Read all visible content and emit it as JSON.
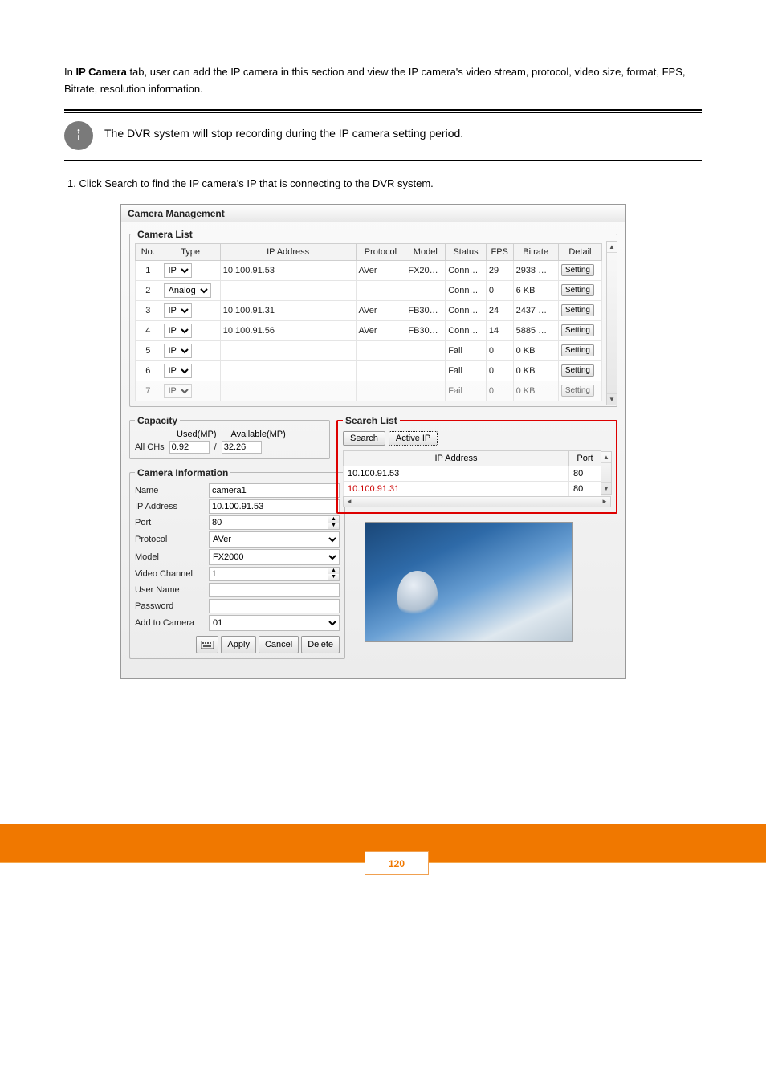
{
  "intro": {
    "part1_prefix": "In ",
    "part1_bold": "IP Camera",
    "part1_suffix": " tab, user can add the IP camera in this section and view the IP camera's video stream, protocol, video size, format, FPS, Bitrate, resolution information."
  },
  "info_note": "The DVR system will stop recording during the IP camera setting period.",
  "step_text": "1. Click Search to find the IP camera's IP that is connecting to the DVR system.",
  "window": {
    "title": "Camera Management",
    "camera_list": {
      "legend": "Camera List",
      "cols": {
        "no": "No.",
        "type": "Type",
        "ip": "IP Address",
        "protocol": "Protocol",
        "model": "Model",
        "status": "Status",
        "fps": "FPS",
        "bitrate": "Bitrate",
        "detail": "Detail"
      },
      "rows": [
        {
          "no": "1",
          "type": "IP",
          "ip": "10.100.91.53",
          "protocol": "AVer",
          "model": "FX20…",
          "status": "Conn…",
          "fps": "29",
          "bitrate": "2938 …",
          "detail": "Setting"
        },
        {
          "no": "2",
          "type": "Analog",
          "ip": "",
          "protocol": "",
          "model": "",
          "status": "Conn…",
          "fps": "0",
          "bitrate": "6 KB",
          "detail": "Setting"
        },
        {
          "no": "3",
          "type": "IP",
          "ip": "10.100.91.31",
          "protocol": "AVer",
          "model": "FB30…",
          "status": "Conn…",
          "fps": "24",
          "bitrate": "2437 …",
          "detail": "Setting"
        },
        {
          "no": "4",
          "type": "IP",
          "ip": "10.100.91.56",
          "protocol": "AVer",
          "model": "FB30…",
          "status": "Conn…",
          "fps": "14",
          "bitrate": "5885 …",
          "detail": "Setting"
        },
        {
          "no": "5",
          "type": "IP",
          "ip": "",
          "protocol": "",
          "model": "",
          "status": "Fail",
          "fps": "0",
          "bitrate": "0 KB",
          "detail": "Setting"
        },
        {
          "no": "6",
          "type": "IP",
          "ip": "",
          "protocol": "",
          "model": "",
          "status": "Fail",
          "fps": "0",
          "bitrate": "0 KB",
          "detail": "Setting"
        },
        {
          "no": "7",
          "type": "IP",
          "ip": "",
          "protocol": "",
          "model": "",
          "status": "Fail",
          "fps": "0",
          "bitrate": "0 KB",
          "detail": "Setting"
        }
      ]
    },
    "capacity": {
      "legend": "Capacity",
      "used_label": "Used(MP)",
      "avail_label": "Available(MP)",
      "allchs": "All CHs",
      "used": "0.92",
      "sep": "/",
      "avail": "32.26"
    },
    "camera_info": {
      "legend": "Camera Information",
      "labels": {
        "name": "Name",
        "ip": "IP Address",
        "port": "Port",
        "protocol": "Protocol",
        "model": "Model",
        "video_channel": "Video Channel",
        "user": "User Name",
        "pass": "Password",
        "add": "Add to Camera"
      },
      "values": {
        "name": "camera1",
        "ip": "10.100.91.53",
        "port": "80",
        "protocol": "AVer",
        "model": "FX2000",
        "video_channel": "1",
        "user": "",
        "pass": "",
        "add": "01"
      },
      "buttons": {
        "apply": "Apply",
        "cancel": "Cancel",
        "delete": "Delete"
      }
    },
    "search_list": {
      "legend": "Search List",
      "search_btn": "Search",
      "active_ip_btn": "Active IP",
      "cols": {
        "ip": "IP Address",
        "port": "Port"
      },
      "rows": [
        {
          "ip": "10.100.91.53",
          "port": "80"
        },
        {
          "ip": "10.100.91.31",
          "port": "80"
        }
      ]
    }
  },
  "page_number": "120"
}
